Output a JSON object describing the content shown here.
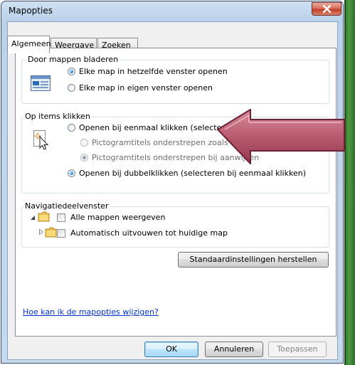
{
  "window": {
    "title": "Mapopties"
  },
  "tabs": [
    {
      "label": "Algemeen",
      "active": true
    },
    {
      "label": "Weergave",
      "active": false
    },
    {
      "label": "Zoeken",
      "active": false
    }
  ],
  "browse_folders": {
    "legend": "Door mappen bladeren",
    "options": [
      {
        "label": "Elke map in hetzelfde venster openen",
        "checked": true
      },
      {
        "label": "Elke map in eigen venster openen",
        "checked": false
      }
    ]
  },
  "click_items": {
    "legend": "Op items klikken",
    "options": [
      {
        "label": "Openen bij eenmaal klikken (selecteren bij aanwijzen)",
        "checked": false,
        "enabled": true
      },
      {
        "label": "Pictogramtitels onderstrepen zoals in de browser",
        "checked": false,
        "enabled": false
      },
      {
        "label": "Pictogramtitels onderstrepen bij aanwijzen",
        "checked": true,
        "enabled": false
      },
      {
        "label": "Openen bij dubbelklikken (selecteren bij eenmaal klikken)",
        "checked": true,
        "enabled": true
      }
    ]
  },
  "navigation_pane": {
    "legend": "Navigatiedeelvenster",
    "options": [
      {
        "label": "Alle mappen weergeven",
        "checked": false
      },
      {
        "label": "Automatisch uitvouwen tot huidige map",
        "checked": false
      }
    ]
  },
  "restore_defaults_label": "Standaardinstellingen herstellen",
  "help_link": "Hoe kan ik de mapopties wijzigen?",
  "footer": {
    "ok": "OK",
    "cancel": "Annuleren",
    "apply": "Toepassen"
  },
  "colors": {
    "highlight_arrow": "#b45a6f",
    "link": "#0033cc",
    "desktop": "#3f8a38"
  }
}
